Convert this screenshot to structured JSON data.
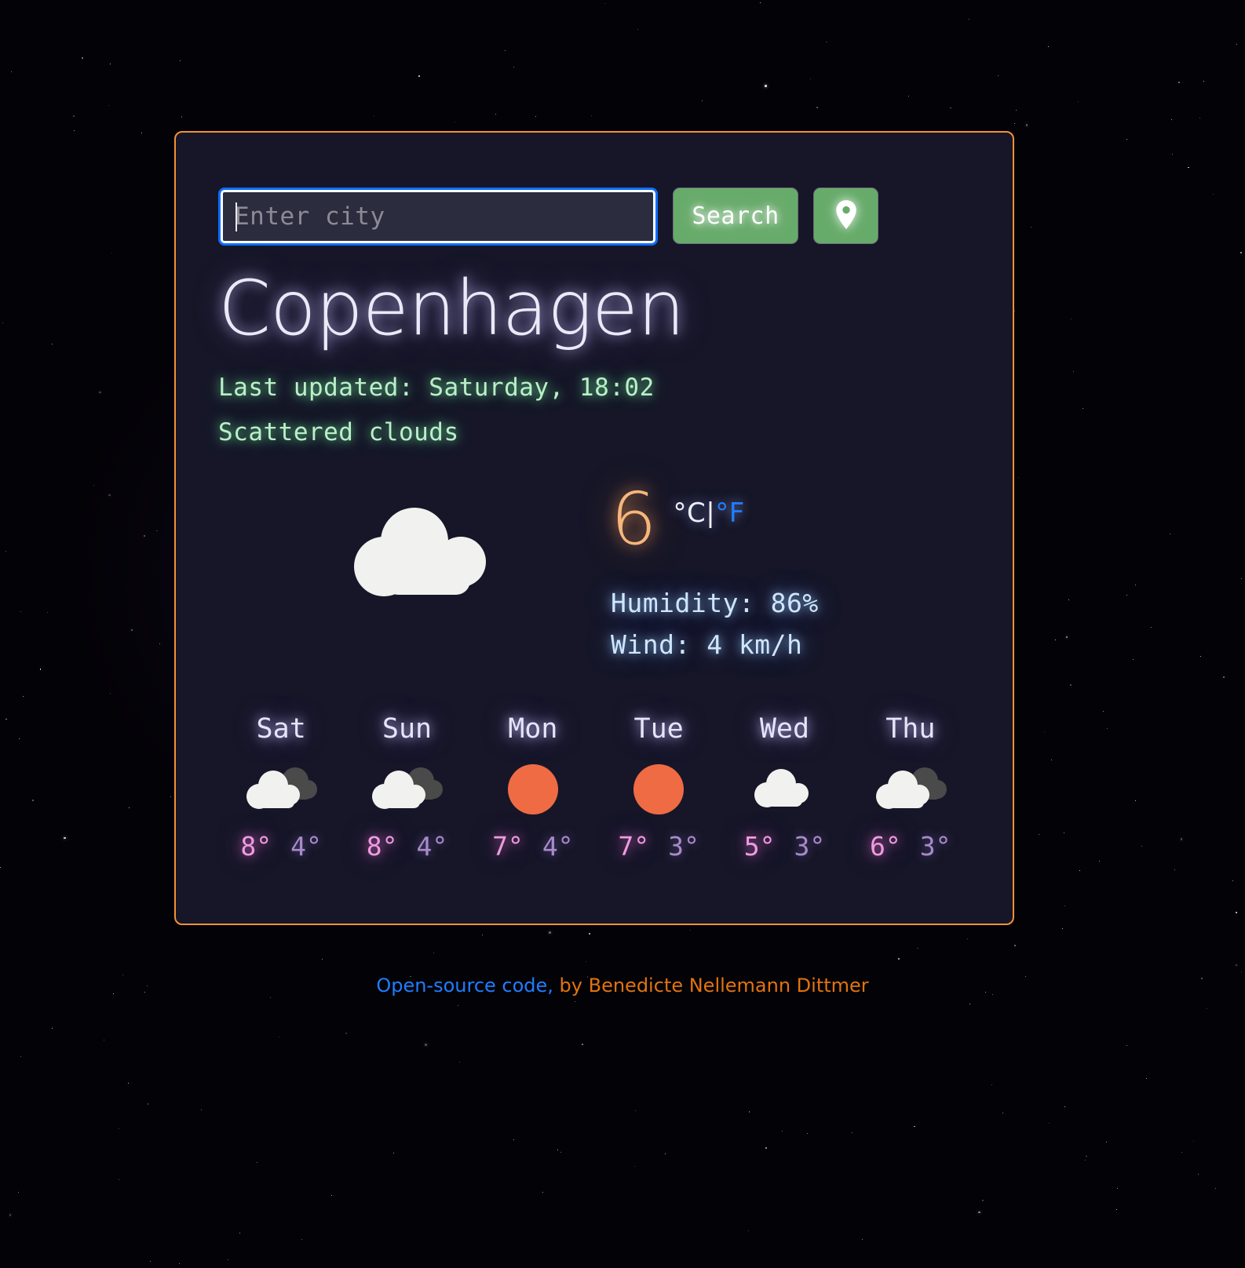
{
  "search": {
    "placeholder": "Enter city",
    "value": "",
    "search_label": "Search",
    "geolocation_icon": "map-pin-icon"
  },
  "current": {
    "city": "Copenhagen",
    "last_updated": "Last updated: Saturday, 18:02",
    "description": "Scattered clouds",
    "icon": "scattered-clouds-icon",
    "temperature": "6",
    "unit_celsius": "°C",
    "unit_separator": "|",
    "unit_fahrenheit": "°F",
    "humidity": "Humidity: 86%",
    "wind": "Wind: 4 km/h"
  },
  "forecast": [
    {
      "day": "Sat",
      "icon": "broken-clouds-icon",
      "max": "8°",
      "min": "4°"
    },
    {
      "day": "Sun",
      "icon": "broken-clouds-icon",
      "max": "8°",
      "min": "4°"
    },
    {
      "day": "Mon",
      "icon": "clear-sky-icon",
      "max": "7°",
      "min": "4°"
    },
    {
      "day": "Tue",
      "icon": "clear-sky-icon",
      "max": "7°",
      "min": "3°"
    },
    {
      "day": "Wed",
      "icon": "scattered-clouds-icon",
      "max": "5°",
      "min": "3°"
    },
    {
      "day": "Thu",
      "icon": "broken-clouds-icon",
      "max": "6°",
      "min": "3°"
    }
  ],
  "footer": {
    "link_label": "Open-source code,",
    "credit": " by Benedicte Nellemann Dittmer"
  },
  "colors": {
    "card_border": "#f59135",
    "card_background": "#161628",
    "button_green": "#67ab6a",
    "input_focus": "#0d6efd",
    "link_blue": "#1f7dff",
    "credit_orange": "#e2730f",
    "temp_orange": "#f6b67c",
    "meta_green": "#b9f0c8",
    "detail_blue": "#cfe6fb",
    "tmax_pink": "#f09be0",
    "tmin_purple": "#a78bc9",
    "sun_orange": "#ef6b44",
    "cloud_white": "#f1f1ef",
    "cloud_dark": "#4a4a4a"
  }
}
